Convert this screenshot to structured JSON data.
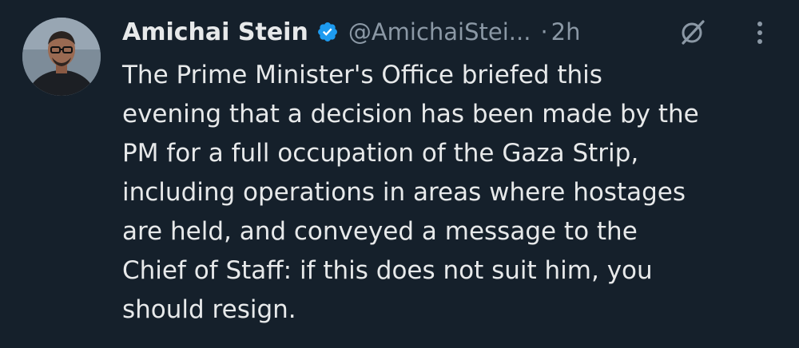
{
  "tweet": {
    "author_name": "Amichai Stein",
    "handle": "@AmichaiStei...",
    "separator": "·",
    "time": "2h",
    "verified_color": "#1d9bf0",
    "text": "The Prime Minister's Office briefed this\nevening that a decision has been made by the\nPM for a full occupation of the Gaza Strip,\nincluding operations in areas where hostages\nare held, and conveyed a message to the\nChief of Staff: if this does not suit him, you\nshould resign."
  },
  "icons": {
    "verified": "verified-badge-icon",
    "grok": "grok-icon",
    "more": "more-options-icon"
  },
  "colors": {
    "background": "#15202b",
    "text": "#e7e9ea",
    "secondary_text": "#8b98a5",
    "accent": "#1d9bf0"
  }
}
